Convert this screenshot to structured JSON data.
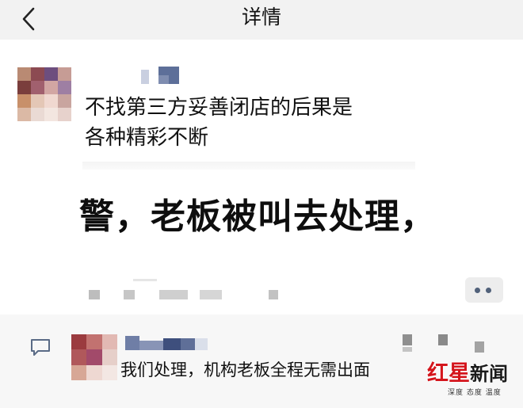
{
  "header": {
    "title": "详情",
    "back_icon": "chevron-left-icon"
  },
  "post": {
    "text_lines": [
      "不找第三方妥善闭店的后果是",
      "各种精彩不断"
    ],
    "screenshot_text": "警，老板被叫去处理，"
  },
  "comment": {
    "text": "我们处理，机构老板全程无需出面",
    "icon": "comment-bubble-icon"
  },
  "more_button": {
    "icon": "more-dots-icon"
  },
  "watermark": {
    "brand_red": "红星",
    "brand_black": "新闻",
    "tagline": "深度 态度 温度"
  },
  "colors": {
    "accent_dots": "#51617a",
    "watermark_red": "#d4151c",
    "comment_icon": "#5a6b86"
  }
}
